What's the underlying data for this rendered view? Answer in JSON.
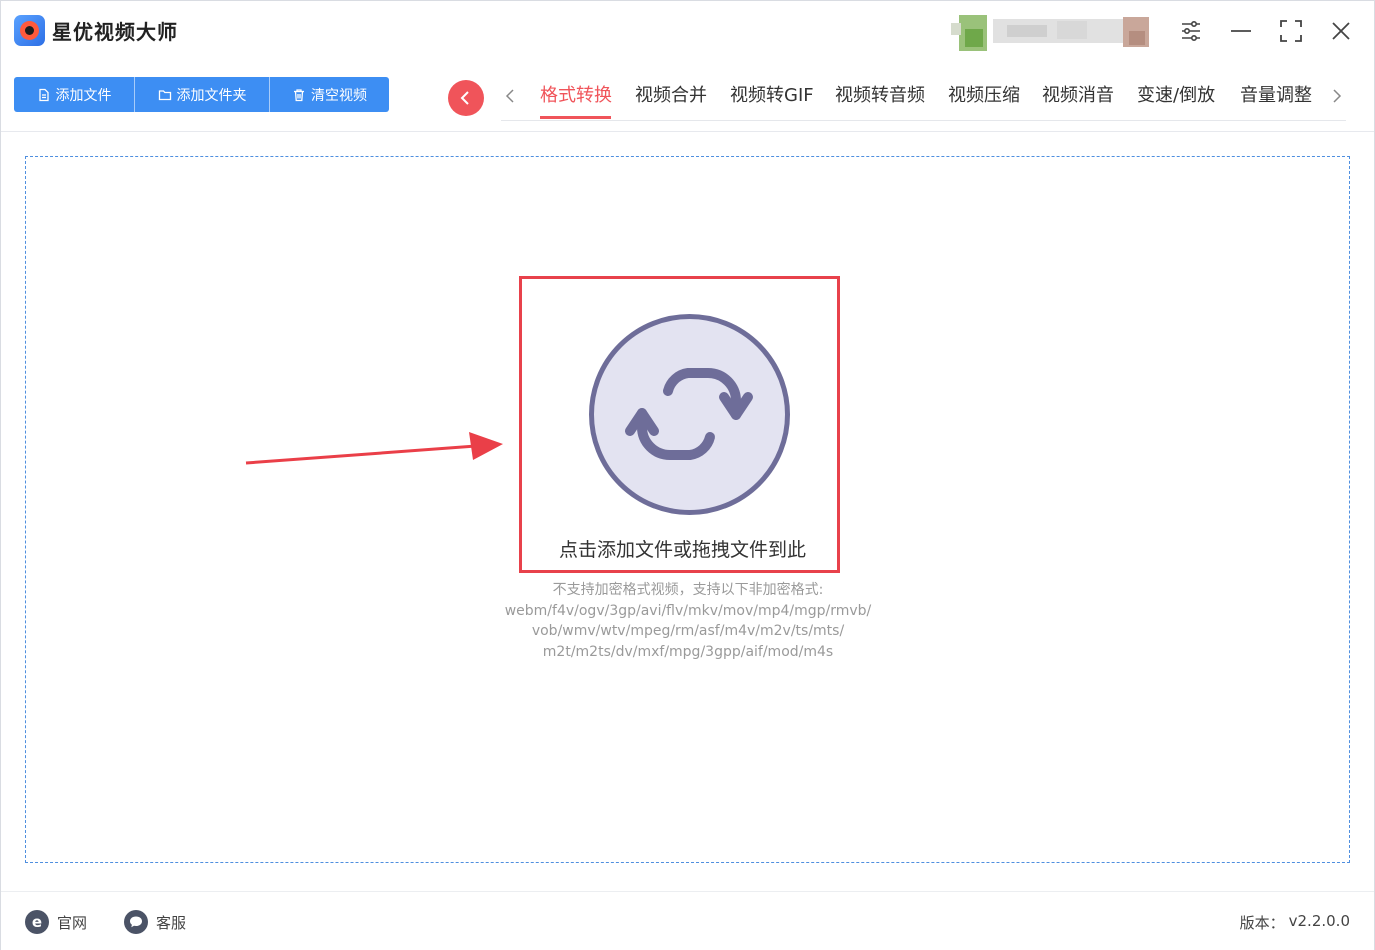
{
  "app": {
    "title": "星优视频大师",
    "accent_color": "#f0545a",
    "primary_color": "#3d8ef3"
  },
  "window_controls": {
    "settings_icon": "sliders-icon",
    "minimize_icon": "minimize-icon",
    "maximize_icon": "maximize-icon",
    "close_icon": "close-icon"
  },
  "toolbar": {
    "buttons": [
      {
        "label": "添加文件",
        "icon": "file-icon"
      },
      {
        "label": "添加文件夹",
        "icon": "folder-icon"
      },
      {
        "label": "清空视频",
        "icon": "trash-icon"
      }
    ]
  },
  "tabs": {
    "items": [
      {
        "label": "格式转换",
        "active": true
      },
      {
        "label": "视频合并",
        "active": false
      },
      {
        "label": "视频转GIF",
        "active": false
      },
      {
        "label": "视频转音频",
        "active": false
      },
      {
        "label": "视频压缩",
        "active": false
      },
      {
        "label": "视频消音",
        "active": false
      },
      {
        "label": "变速/倒放",
        "active": false
      },
      {
        "label": "音量调整",
        "active": false
      }
    ]
  },
  "dropzone": {
    "label": "点击添加文件或拖拽文件到此",
    "formats_lines": [
      "不支持加密格式视频，支持以下非加密格式:",
      "webm/f4v/ogv/3gp/avi/flv/mkv/mov/mp4/mgp/rmvb/",
      "vob/wmv/wtv/mpeg/rm/asf/m4v/m2v/ts/mts/",
      "m2t/m2ts/dv/mxf/mpg/3gpp/aif/mod/m4s"
    ]
  },
  "footer": {
    "website_label": "官网",
    "support_label": "客服",
    "version_label": "版本：",
    "version_value": "v2.2.0.0"
  }
}
